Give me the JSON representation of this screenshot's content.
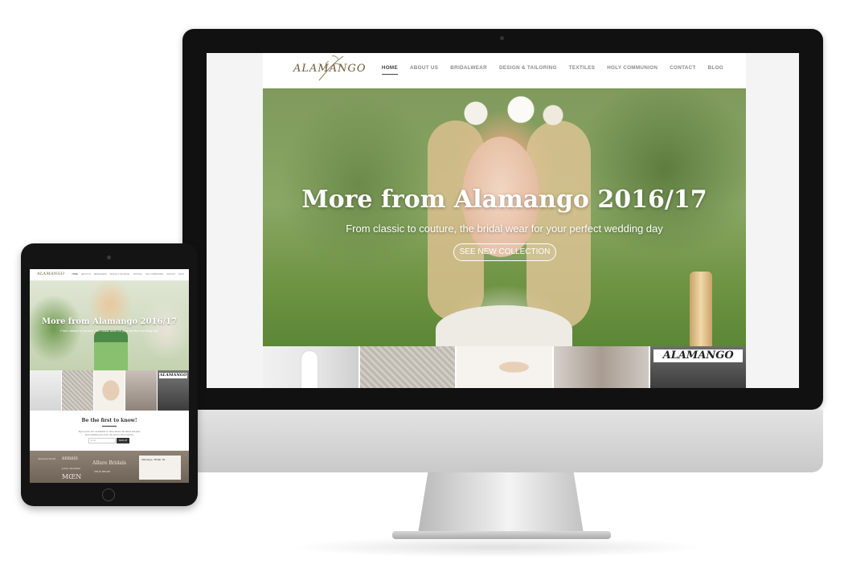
{
  "desktop": {
    "site": {
      "logo": "ALAMANGO",
      "nav": [
        "HOME",
        "ABOUT US",
        "BRIDALWEAR",
        "DESIGN & TAILORING",
        "TEXTILES",
        "HOLY COMMUNION",
        "CONTACT",
        "BLOG"
      ],
      "active_nav": "HOME"
    },
    "hero": {
      "title": "More from Alamango 2016/17",
      "subtitle": "From classic to couture, the bridal wear for your perfect wedding day",
      "cta": "SEE NEW COLLECTION"
    },
    "thumbnails": {
      "sign_text": "ALAMANGO"
    }
  },
  "tablet": {
    "logo": "ALAMANGO",
    "nav": [
      "HOME",
      "ABOUT US",
      "BRIDALWEAR",
      "DESIGN & TAILORING",
      "TEXTILES",
      "HOLY COMMUNION",
      "CONTACT",
      "BLOG"
    ],
    "hero": {
      "title": "More from Alamango 2016/17",
      "subtitle": "From classic to couture, the bridal wear for your perfect wedding day"
    },
    "thumb_sign": "ALAMANGO",
    "newsletter": {
      "title": "Be the first to know!",
      "text_line1": "Sign up for our newsletter to hear about the latest dresses",
      "text_line2": "and wedding tips from the best in the industry",
      "input_placeholder": "Email",
      "button": "SIGN UP"
    },
    "brands": {
      "b1": "annais",
      "b2": "Allure Bridals",
      "b3": "MŒN",
      "b4": "TRUE BRIDE",
      "b5": "Alamango - Bridal, Tai",
      "b6": "Amanda Wyatt",
      "b7": "Jenny Packham"
    }
  },
  "colors": {
    "bezel": "#111111",
    "nav_text": "#8a8a8a",
    "logo": "#6d5a3a",
    "brand_strip": "#8f8275"
  }
}
